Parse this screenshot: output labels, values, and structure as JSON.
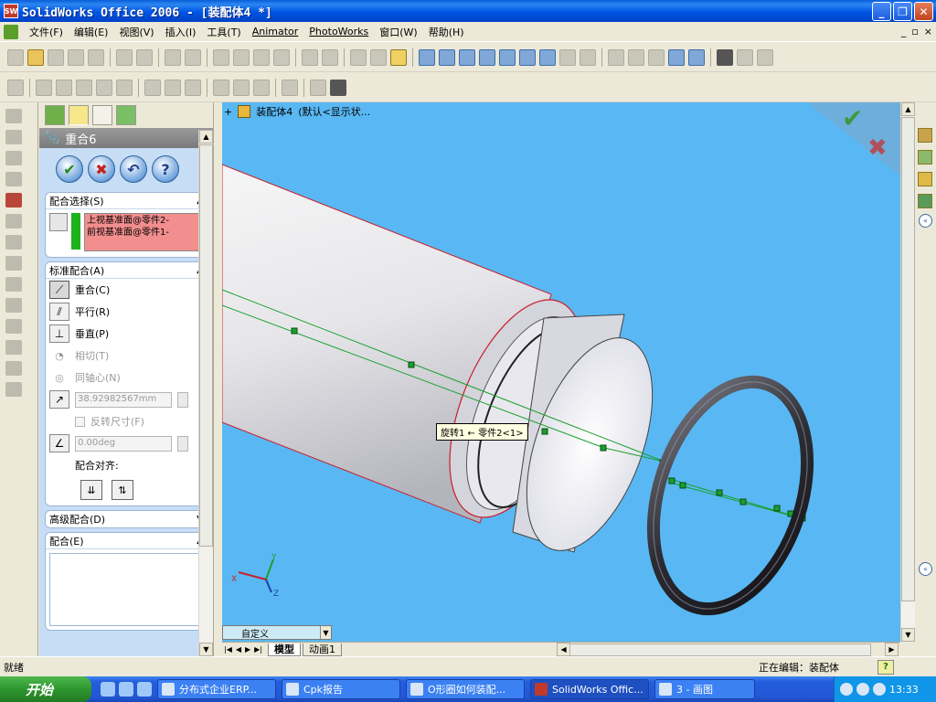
{
  "window": {
    "title": "SolidWorks Office 2006 - [装配体4 *]",
    "app_icon": "SW",
    "buttons": [
      "minimize",
      "restore",
      "close"
    ]
  },
  "menu": {
    "items": [
      "文件(F)",
      "编辑(E)",
      "视图(V)",
      "插入(I)",
      "工具(T)",
      "Animator",
      "PhotoWorks",
      "窗口(W)",
      "帮助(H)"
    ],
    "mdi": [
      "_",
      "▫",
      "×"
    ]
  },
  "property_manager": {
    "title": "重合6",
    "tabs": [
      "feature-manager-tab",
      "property-manager-tab",
      "configuration-manager-tab",
      "display-manager-tab"
    ],
    "actions": {
      "ok": "✔",
      "cancel": "✖",
      "undo": "↶",
      "help": "?"
    },
    "mate_selections": {
      "label": "配合选择(S)",
      "items": [
        "上视基准面@零件2-",
        "前视基准面@零件1-"
      ]
    },
    "standard_mates": {
      "label": "标准配合(A)",
      "coincident": "重合(C)",
      "parallel": "平行(R)",
      "perpendicular": "垂直(P)",
      "tangent": "相切(T)",
      "concentric": "同轴心(N)",
      "distance_value": "38.92982567mm",
      "flip_dimension": "反转尺寸(F)",
      "angle_value": "0.00deg",
      "alignment_label": "配合对齐:"
    },
    "advanced_mates": {
      "label": "高级配合(D)"
    },
    "mates": {
      "label": "配合(E)"
    }
  },
  "viewport": {
    "tree_label": "装配体4",
    "display_state": "(默认<显示状...",
    "tooltip": "旋转1 ← 零件2<1>",
    "view_orientation": "自定义",
    "background_color": "#59B8F3",
    "tabs": [
      "模型",
      "动画1"
    ],
    "triad": {
      "x": "X",
      "y": "Y",
      "z": "Z"
    },
    "confirm_ok": "✔",
    "confirm_cancel": "✖"
  },
  "status": {
    "left": "就绪",
    "right": "正在编辑：装配体",
    "help": "?"
  },
  "taskbar": {
    "start": "开始",
    "tasks": [
      "分布式企业ERP...",
      "Cpk报告",
      "O形圈如何装配...",
      "SolidWorks Offic...",
      "3 - 画图"
    ],
    "active_task_index": 3,
    "clock": "13:33"
  }
}
